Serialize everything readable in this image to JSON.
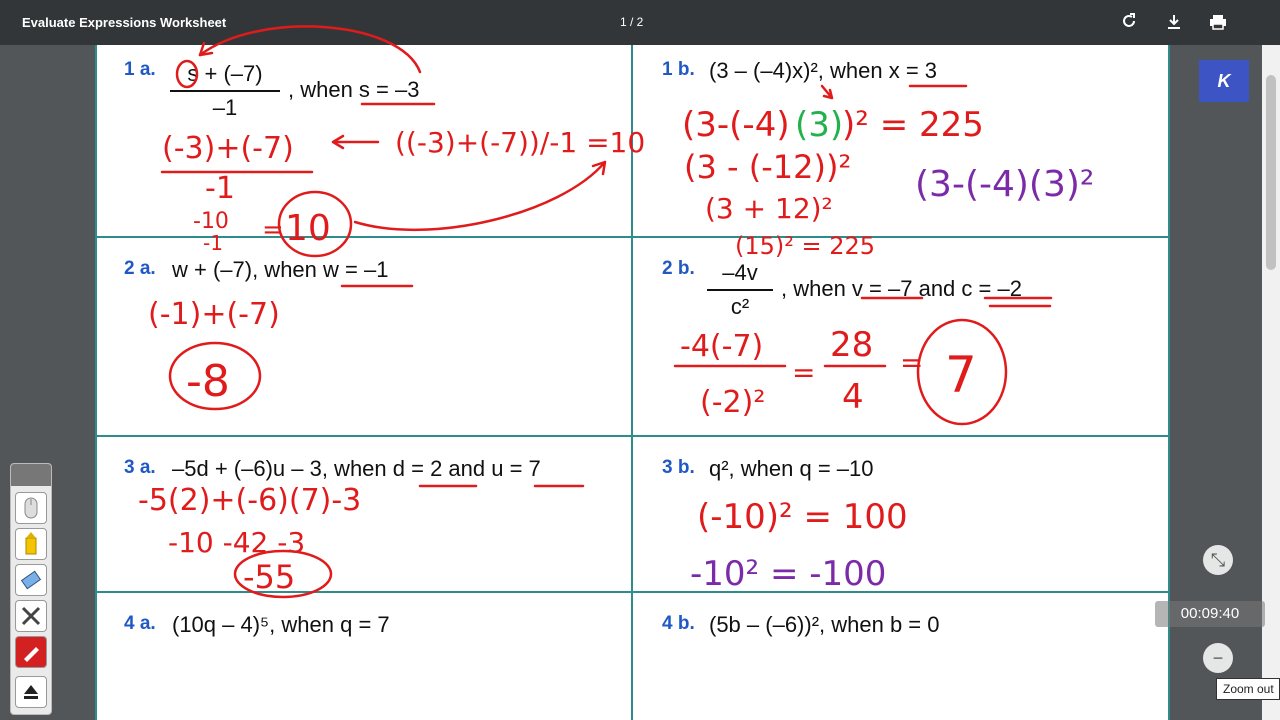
{
  "toolbar": {
    "title": "Evaluate Expressions Worksheet",
    "page_indicator": "1 / 2"
  },
  "problems": {
    "p1a": {
      "label": "1 a.",
      "num": "s + (–7)",
      "den": "–1",
      "tail": ", when s = –3"
    },
    "p1b": {
      "label": "1 b.",
      "expr": "(3 – (–4)x)², when x = 3"
    },
    "p2a": {
      "label": "2 a.",
      "expr": "w + (–7), when w = –1"
    },
    "p2b": {
      "label": "2 b.",
      "num": "–4v",
      "den": "c²",
      "tail": ", when v = –7 and c = –2"
    },
    "p3a": {
      "label": "3 a.",
      "expr": "–5d + (–6)u – 3, when d = 2 and u = 7"
    },
    "p3b": {
      "label": "3 b.",
      "expr": "q², when q = –10"
    },
    "p4a": {
      "label": "4 a.",
      "expr": "(10q – 4)⁵, when q = 7"
    },
    "p4b": {
      "label": "4 b.",
      "expr": "(5b – (–6))², when b = 0"
    }
  },
  "handwriting": {
    "p1a_line1": "(-3)+(-7)",
    "p1a_den": "-1",
    "p1a_line2": "-10",
    "p1a_line2_den": "-1",
    "p1a_eq": "=",
    "p1a_answer": "10",
    "p1a_side": "((-3)+(-7))/-1 =10",
    "p1b_line1a": "(3-(-4)",
    "p1b_line1b": "(3)",
    "p1b_line1c": ")² = 225",
    "p1b_line2": "(3 - (-12))²",
    "p1b_line3": "(3 + 12)²",
    "p1b_line4": "(15)² = 225",
    "p1b_purple": "(3-(-4)(3)²",
    "p2a_line1": "(-1)+(-7)",
    "p2a_answer": "-8",
    "p2b_num": "-4(-7)",
    "p2b_den": "(-2)²",
    "p2b_mid_num": "28",
    "p2b_mid_den": "4",
    "p2b_eq1": "=",
    "p2b_eq2": "=",
    "p2b_answer": "7",
    "p3a_line1": "-5(2)+(-6)(7)-3",
    "p3a_line2": "-10   -42   -3",
    "p3a_answer": "-55",
    "p3b_line1": "(-10)² = 100",
    "p3b_line2": "-10² = -100"
  },
  "side": {
    "k_button": "K",
    "timer": "00:09:40",
    "zoom_out_tooltip": "Zoom out",
    "zoom_out_symbol": "−",
    "fit_symbol": "⤡"
  },
  "colors": {
    "ink_red": "#e01b1b",
    "ink_green": "#22b14c",
    "ink_purple": "#7b2aa8",
    "grid": "#2f8c8c",
    "label_blue": "#2159c4"
  }
}
